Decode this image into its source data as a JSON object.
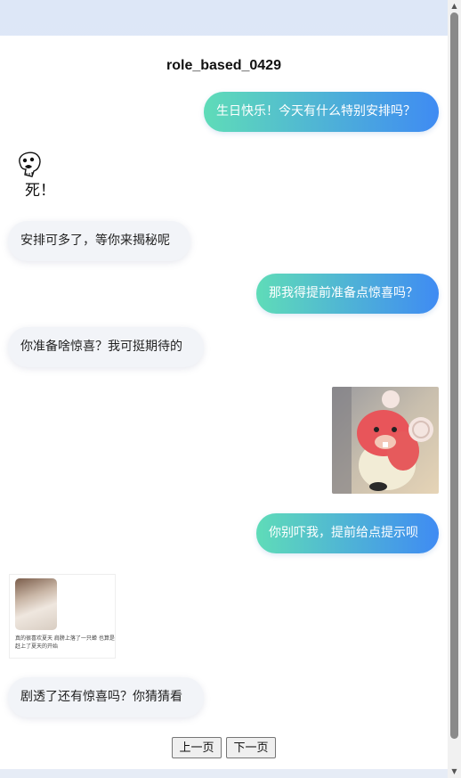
{
  "page": {
    "title": "role_based_0429"
  },
  "messages": [
    {
      "role": "user",
      "type": "text",
      "text": "生日快乐！今天有什么特别安排吗？"
    },
    {
      "role": "bot",
      "type": "sticker",
      "sticker_text": "死！",
      "icon": "skull-doodle-icon"
    },
    {
      "role": "bot",
      "type": "text",
      "text": "安排可多了，等你来揭秘呢"
    },
    {
      "role": "user",
      "type": "text",
      "text": "那我得提前准备点惊喜吗？"
    },
    {
      "role": "bot",
      "type": "text",
      "text": "你准备啥惊喜？我可挺期待的"
    },
    {
      "role": "user",
      "type": "image",
      "image": "pink-beaver-toy-photo"
    },
    {
      "role": "user",
      "type": "text",
      "text": "你别吓我，提前给点提示呗"
    },
    {
      "role": "bot",
      "type": "image",
      "image": "meme-screenshot",
      "caption": "真的很喜欢夏天 肩膀上落了一只蝉 也算是赶上了夏天的开始"
    },
    {
      "role": "bot",
      "type": "text",
      "text": "剧透了还有惊喜吗？你猜猜看"
    }
  ],
  "pagination": {
    "prev_label": "上一页",
    "next_label": "下一页"
  },
  "colors": {
    "user_bubble_start": "#5fdcb8",
    "user_bubble_end": "#3f8bf3",
    "bot_bubble": "#f2f4f8",
    "page_background": "#dde7f7"
  }
}
